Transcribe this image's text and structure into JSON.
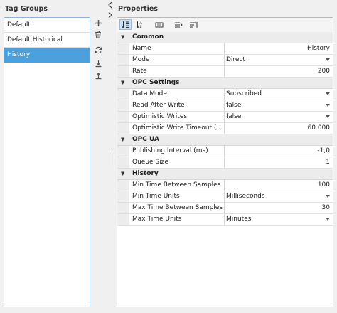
{
  "left_panel": {
    "title": "Tag Groups",
    "items": [
      {
        "label": "Default",
        "selected": false
      },
      {
        "label": "Default Historical",
        "selected": false
      },
      {
        "label": "History",
        "selected": true
      }
    ],
    "tools": [
      {
        "icon": "add-icon"
      },
      {
        "icon": "delete-icon"
      },
      {
        "icon": "refresh-icon"
      },
      {
        "icon": "import-icon"
      },
      {
        "icon": "export-icon"
      }
    ]
  },
  "right_panel": {
    "title": "Properties",
    "toolbar": [
      {
        "icon": "sort-categorized-icon",
        "active": true
      },
      {
        "icon": "sort-alphabetical-icon",
        "active": false
      },
      {
        "icon": "property-pages-icon",
        "active": false
      },
      {
        "icon": "expand-all-icon",
        "active": false
      },
      {
        "icon": "collapse-all-icon",
        "active": false
      }
    ],
    "categories": [
      {
        "name": "Common",
        "rows": [
          {
            "name": "Name",
            "value": "History",
            "align": "right",
            "dropdown": false
          },
          {
            "name": "Mode",
            "value": "Direct",
            "align": "left",
            "dropdown": true
          },
          {
            "name": "Rate",
            "value": "200",
            "align": "right",
            "dropdown": false
          }
        ]
      },
      {
        "name": "OPC Settings",
        "rows": [
          {
            "name": "Data Mode",
            "value": "Subscribed",
            "align": "left",
            "dropdown": true
          },
          {
            "name": "Read After Write",
            "value": "false",
            "align": "left",
            "dropdown": true
          },
          {
            "name": "Optimistic Writes",
            "value": "false",
            "align": "left",
            "dropdown": true
          },
          {
            "name": "Optimistic Write Timeout (...",
            "value": "60 000",
            "align": "right",
            "dropdown": false
          }
        ]
      },
      {
        "name": "OPC UA",
        "rows": [
          {
            "name": "Publishing Interval (ms)",
            "value": "-1,0",
            "align": "right",
            "dropdown": false
          },
          {
            "name": "Queue Size",
            "value": "1",
            "align": "right",
            "dropdown": false
          }
        ]
      },
      {
        "name": "History",
        "rows": [
          {
            "name": "Min Time Between Samples",
            "value": "100",
            "align": "right",
            "dropdown": false
          },
          {
            "name": "Min Time Units",
            "value": "Milliseconds",
            "align": "left",
            "dropdown": true
          },
          {
            "name": "Max Time Between Samples",
            "value": "30",
            "align": "right",
            "dropdown": false
          },
          {
            "name": "Max Time Units",
            "value": "Minutes",
            "align": "left",
            "dropdown": true
          }
        ]
      }
    ]
  },
  "colors": {
    "selection": "#4aa1dd",
    "list_border": "#8fb4d9"
  }
}
